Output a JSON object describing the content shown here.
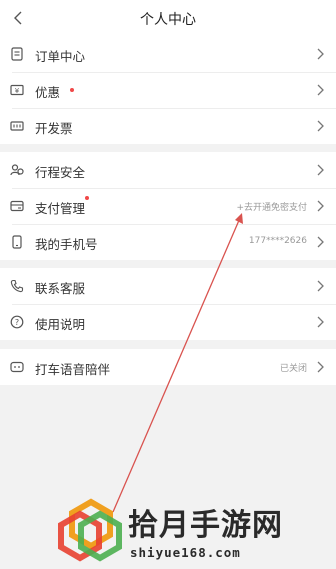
{
  "header": {
    "title": "个人中心"
  },
  "sections": [
    {
      "rows": [
        {
          "icon": "document-icon",
          "label": "订单中心",
          "value": ""
        },
        {
          "icon": "coupon-icon",
          "label": "优惠",
          "value": ""
        },
        {
          "icon": "invoice-icon",
          "label": "开发票",
          "value": ""
        }
      ]
    },
    {
      "rows": [
        {
          "icon": "people-shield-icon",
          "label": "行程安全",
          "value": ""
        },
        {
          "icon": "wallet-icon",
          "label": "支付管理",
          "value": "+去开通免密支付"
        },
        {
          "icon": "phone-icon",
          "label": "我的手机号",
          "value": "177****2626"
        }
      ]
    },
    {
      "rows": [
        {
          "icon": "call-icon",
          "label": "联系客服",
          "value": ""
        },
        {
          "icon": "question-icon",
          "label": "使用说明",
          "value": ""
        }
      ]
    },
    {
      "rows": [
        {
          "icon": "voice-companion-icon",
          "label": "打车语音陪伴",
          "value": "已关闭"
        }
      ]
    }
  ],
  "watermark": {
    "title": "拾月手游网",
    "url": "shiyue168.com"
  },
  "colors": {
    "badge": "#f04848",
    "annotation": "#d9534f"
  }
}
